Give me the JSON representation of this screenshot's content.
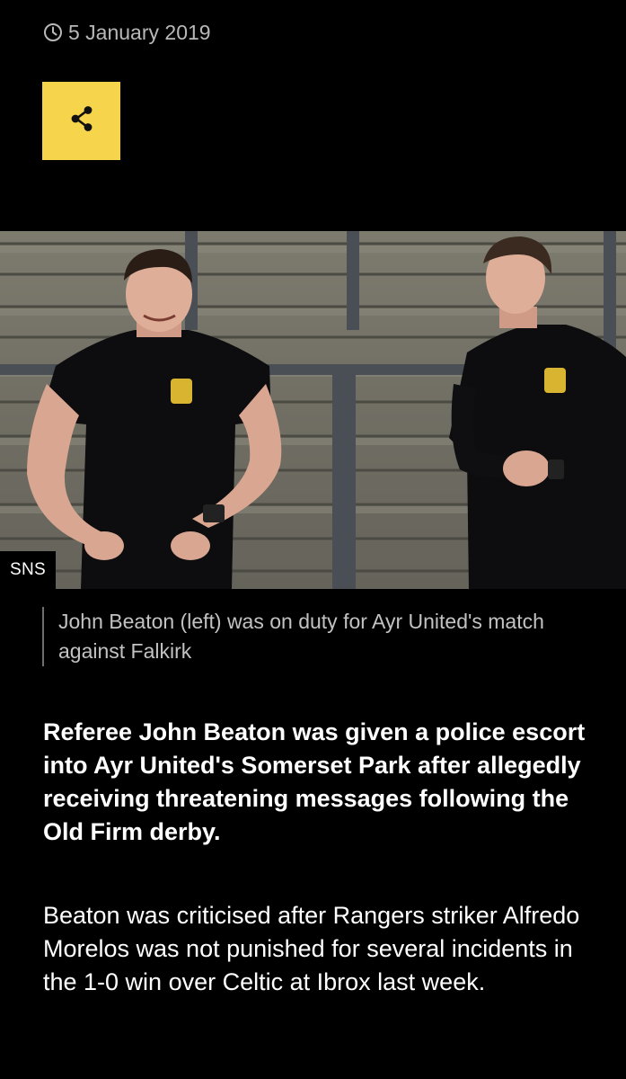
{
  "article": {
    "date": "5 January 2019",
    "share_icon": "share-icon",
    "clock_icon": "clock-icon",
    "image": {
      "credit": "SNS",
      "caption": "John Beaton (left) was on duty for Ayr United's match against Falkirk"
    },
    "lede": "Referee John Beaton was given a police escort into Ayr United's Somerset Park after allegedly receiving threatening messages following the Old Firm derby.",
    "paragraphs": [
      "Beaton was criticised after Rangers striker Alfredo Morelos was not punished for several incidents in the 1-0 win over Celtic at Ibrox last week."
    ]
  },
  "colors": {
    "background": "#000000",
    "share_button": "#f6d44c",
    "caption_text": "#c2c2c2",
    "date_text": "#b8b8b8"
  }
}
